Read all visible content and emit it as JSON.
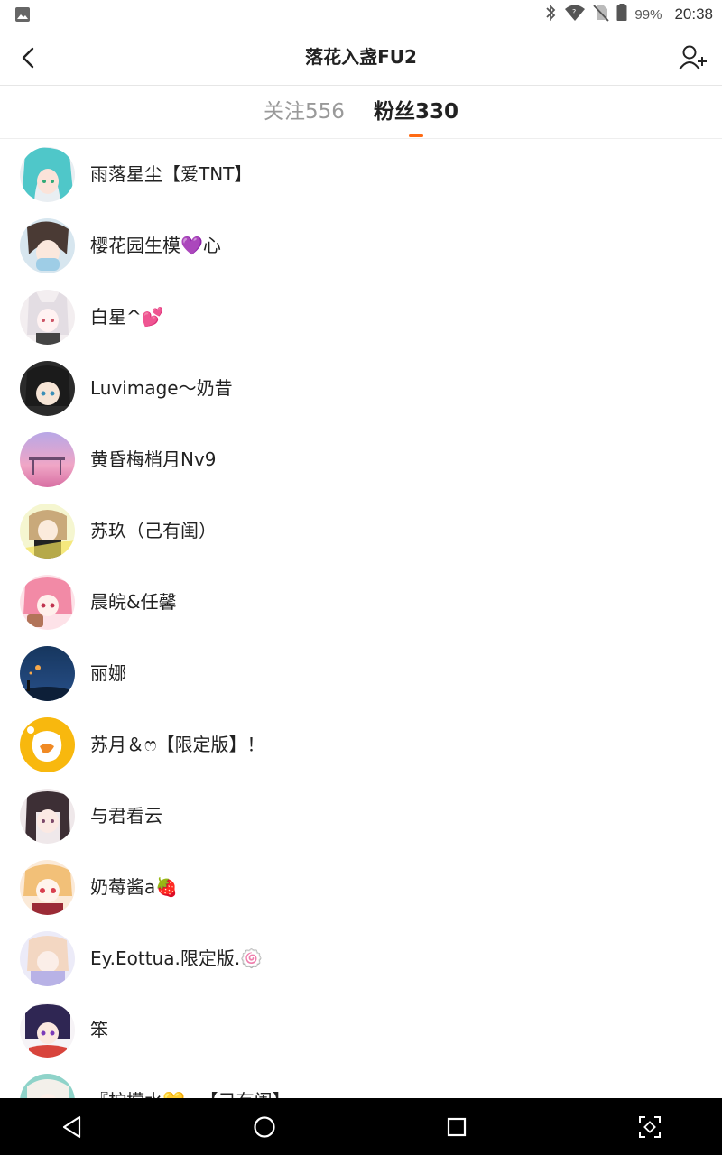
{
  "status_bar": {
    "battery": "99%",
    "time": "20:38",
    "icons": [
      "image-icon",
      "bluetooth-icon",
      "wifi-icon",
      "no-sim-icon",
      "battery-icon"
    ]
  },
  "header": {
    "title": "落花入盏FU2",
    "back_icon": "back-arrow-icon",
    "add_user_icon": "add-user-icon"
  },
  "tabs": [
    {
      "label": "关注556",
      "active": false
    },
    {
      "label": "粉丝330",
      "active": true
    }
  ],
  "accent_color": "#ff6a13",
  "followers": [
    {
      "name": "雨落星尘【爱TNT】"
    },
    {
      "name": "樱花园生模💜心"
    },
    {
      "name": "白星^💕"
    },
    {
      "name": "Luvimage～奶昔"
    },
    {
      "name": "黄昏梅梢月Nv9"
    },
    {
      "name": "苏玖（己有闺）"
    },
    {
      "name": "晨皖&任馨"
    },
    {
      "name": "丽娜"
    },
    {
      "name": "苏月＆ෆ【限定版】！"
    },
    {
      "name": "与君看云"
    },
    {
      "name": "奶莓酱a🍓"
    },
    {
      "name": "Ey.Eottua.限定版.🍥"
    },
    {
      "name": "笨"
    },
    {
      "name": "『柠檬水💛~【己有闺】"
    }
  ],
  "nav_bar": {
    "icons": [
      "back-triangle-icon",
      "home-circle-icon",
      "recents-square-icon",
      "screenshot-icon"
    ]
  }
}
